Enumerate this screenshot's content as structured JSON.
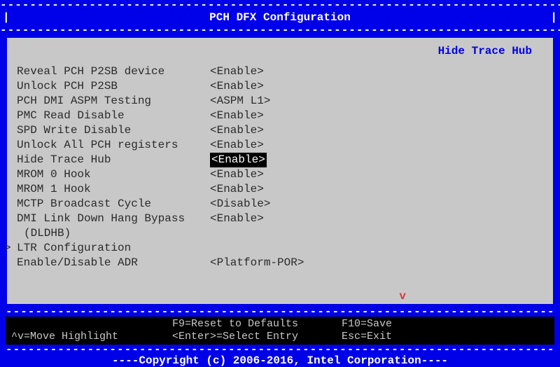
{
  "title": "PCH DFX Configuration",
  "description": "Hide Trace Hub",
  "items": [
    {
      "label": "Reveal PCH P2SB device",
      "value": "<Enable>",
      "selected": false
    },
    {
      "label": "Unlock PCH P2SB",
      "value": "<Enable>",
      "selected": false
    },
    {
      "label": "PCH DMI ASPM Testing",
      "value": "<ASPM L1>",
      "selected": false
    },
    {
      "label": "PMC Read Disable",
      "value": "<Enable>",
      "selected": false
    },
    {
      "label": "SPD Write Disable",
      "value": "<Enable>",
      "selected": false
    },
    {
      "label": "Unlock All PCH registers",
      "value": "<Enable>",
      "selected": false
    },
    {
      "label": "Hide Trace Hub",
      "value": "<Enable>",
      "selected": true
    },
    {
      "label": "MROM 0 Hook",
      "value": "<Enable>",
      "selected": false
    },
    {
      "label": "MROM 1 Hook",
      "value": "<Enable>",
      "selected": false
    },
    {
      "label": "MCTP Broadcast Cycle",
      "value": "<Disable>",
      "selected": false
    },
    {
      "label": "DMI Link Down Hang Bypass",
      "value": "<Enable>",
      "selected": false
    }
  ],
  "continuation": "(DLDHB)",
  "submenu": {
    "label": "LTR Configuration"
  },
  "last": {
    "label": "Enable/Disable ADR",
    "value": "<Platform-POR>"
  },
  "scroll_indicator": "v",
  "help": {
    "r1c1": "",
    "r1c2": "F9=Reset to Defaults",
    "r1c3": "F10=Save",
    "r2c1": "^v=Move Highlight",
    "r2c2": "<Enter>=Select Entry",
    "r2c3": "Esc=Exit"
  },
  "copyright": "Copyright (c) 2006-2016, Intel Corporation",
  "dash_line": "--------------------------------------------------------------------------------------------------------"
}
